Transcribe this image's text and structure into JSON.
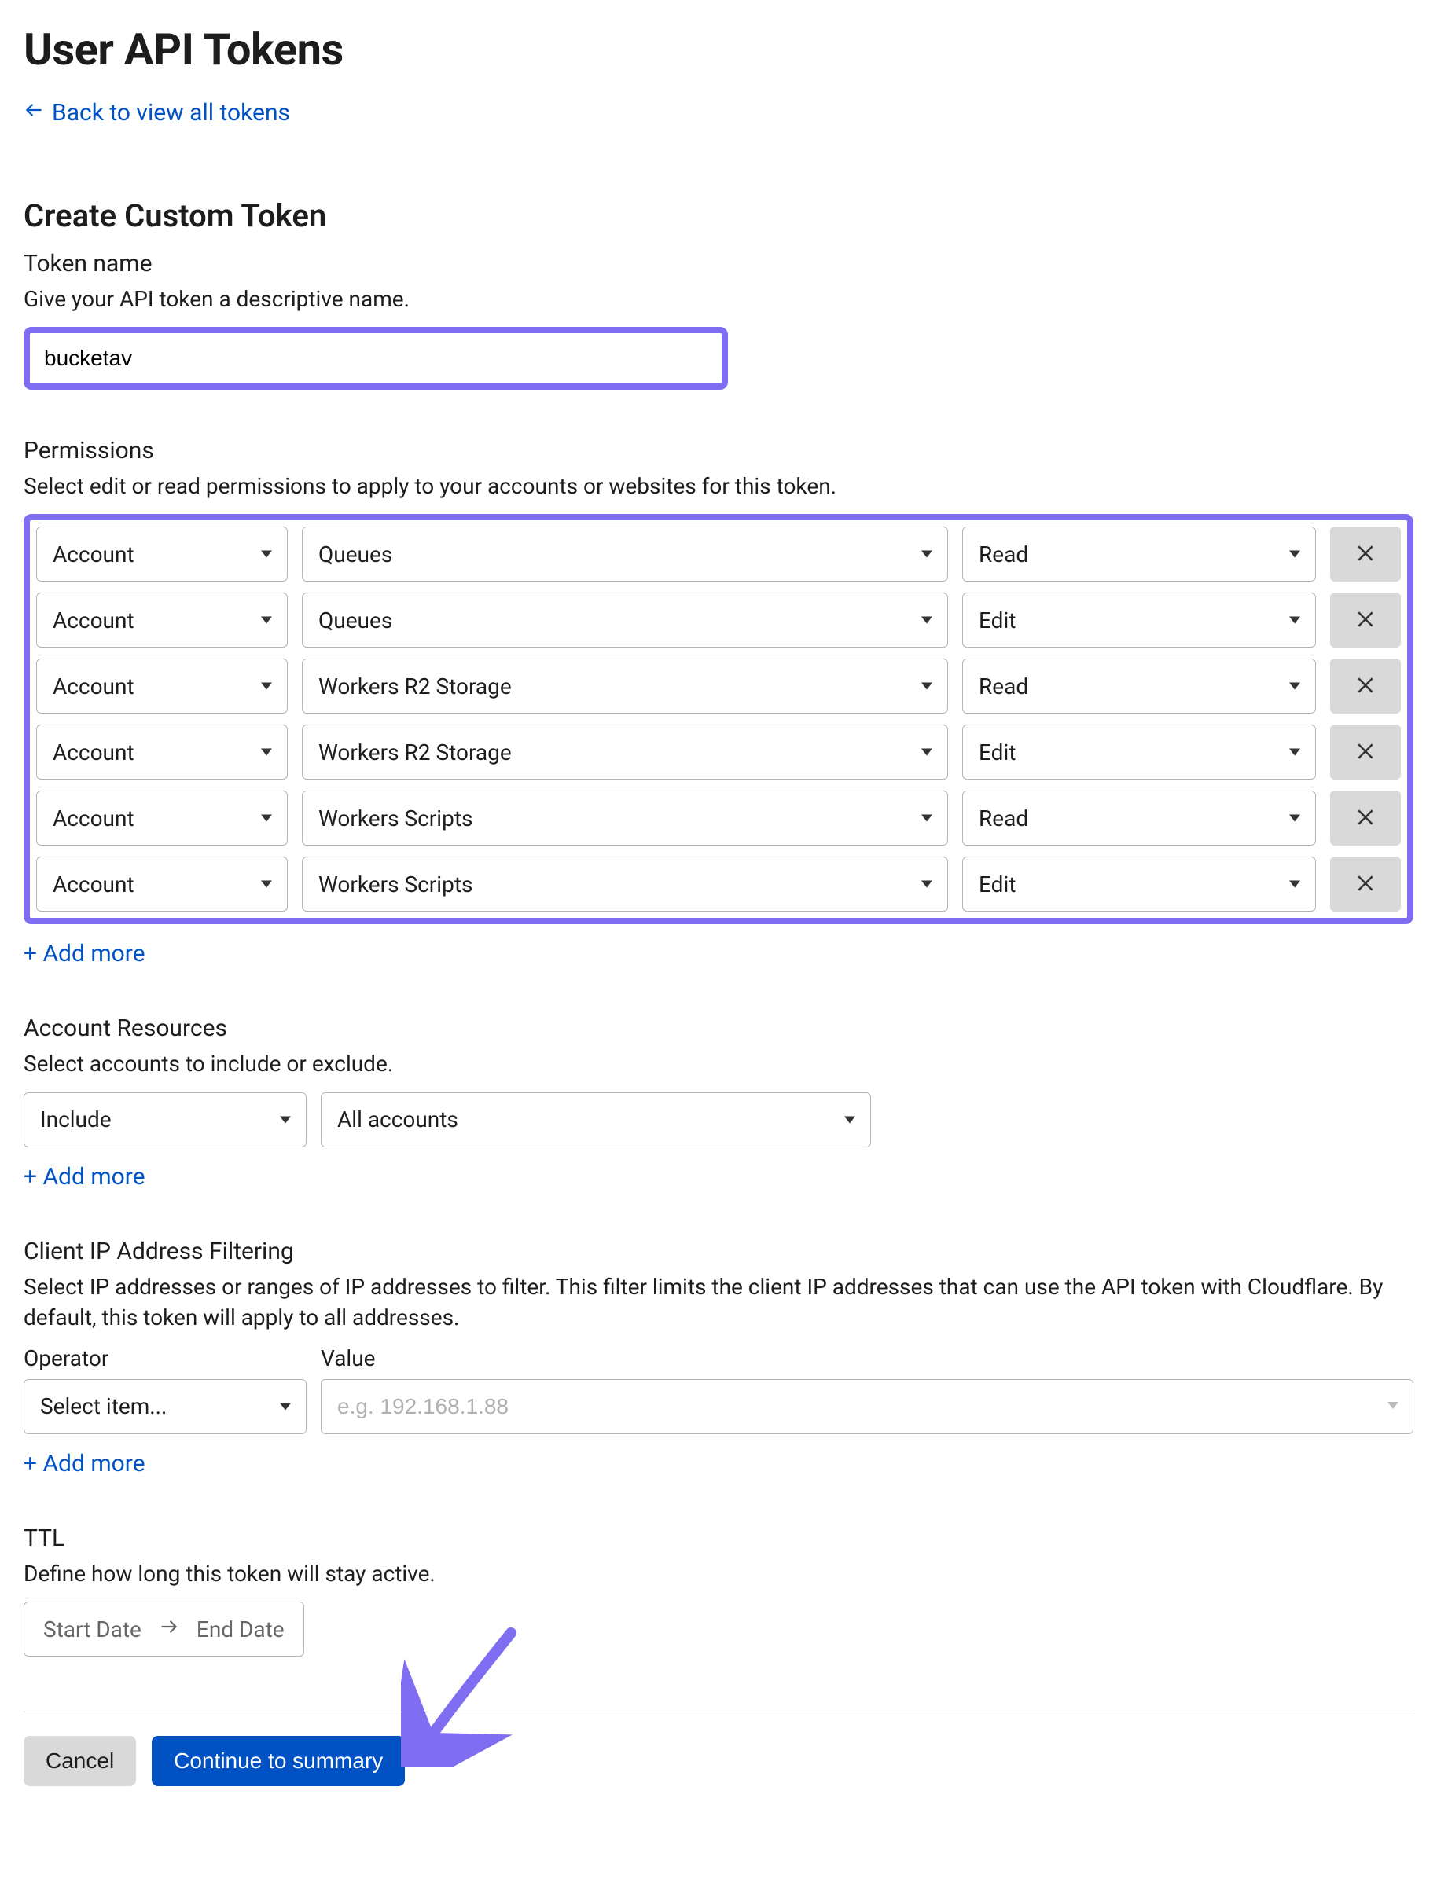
{
  "page": {
    "title": "User API Tokens",
    "back_label": "Back to view all tokens"
  },
  "create": {
    "title": "Create Custom Token",
    "token_name_label": "Token name",
    "token_name_help": "Give your API token a descriptive name.",
    "token_name_value": "bucketav"
  },
  "permissions": {
    "title": "Permissions",
    "help": "Select edit or read permissions to apply to your accounts or websites for this token.",
    "rows": [
      {
        "scope": "Account",
        "resource": "Queues",
        "access": "Read"
      },
      {
        "scope": "Account",
        "resource": "Queues",
        "access": "Edit"
      },
      {
        "scope": "Account",
        "resource": "Workers R2 Storage",
        "access": "Read"
      },
      {
        "scope": "Account",
        "resource": "Workers R2 Storage",
        "access": "Edit"
      },
      {
        "scope": "Account",
        "resource": "Workers Scripts",
        "access": "Read"
      },
      {
        "scope": "Account",
        "resource": "Workers Scripts",
        "access": "Edit"
      }
    ],
    "add_more": "+ Add more"
  },
  "account_resources": {
    "title": "Account Resources",
    "help": "Select accounts to include or exclude.",
    "mode": "Include",
    "target": "All accounts",
    "add_more": "+ Add more"
  },
  "ip_filter": {
    "title": "Client IP Address Filtering",
    "help": "Select IP addresses or ranges of IP addresses to filter. This filter limits the client IP addresses that can use the API token with Cloudflare. By default, this token will apply to all addresses.",
    "operator_label": "Operator",
    "operator_value": "Select item...",
    "value_label": "Value",
    "value_placeholder": "e.g. 192.168.1.88",
    "add_more": "+ Add more"
  },
  "ttl": {
    "title": "TTL",
    "help": "Define how long this token will stay active.",
    "start": "Start Date",
    "end": "End Date"
  },
  "footer": {
    "cancel": "Cancel",
    "continue": "Continue to summary"
  }
}
